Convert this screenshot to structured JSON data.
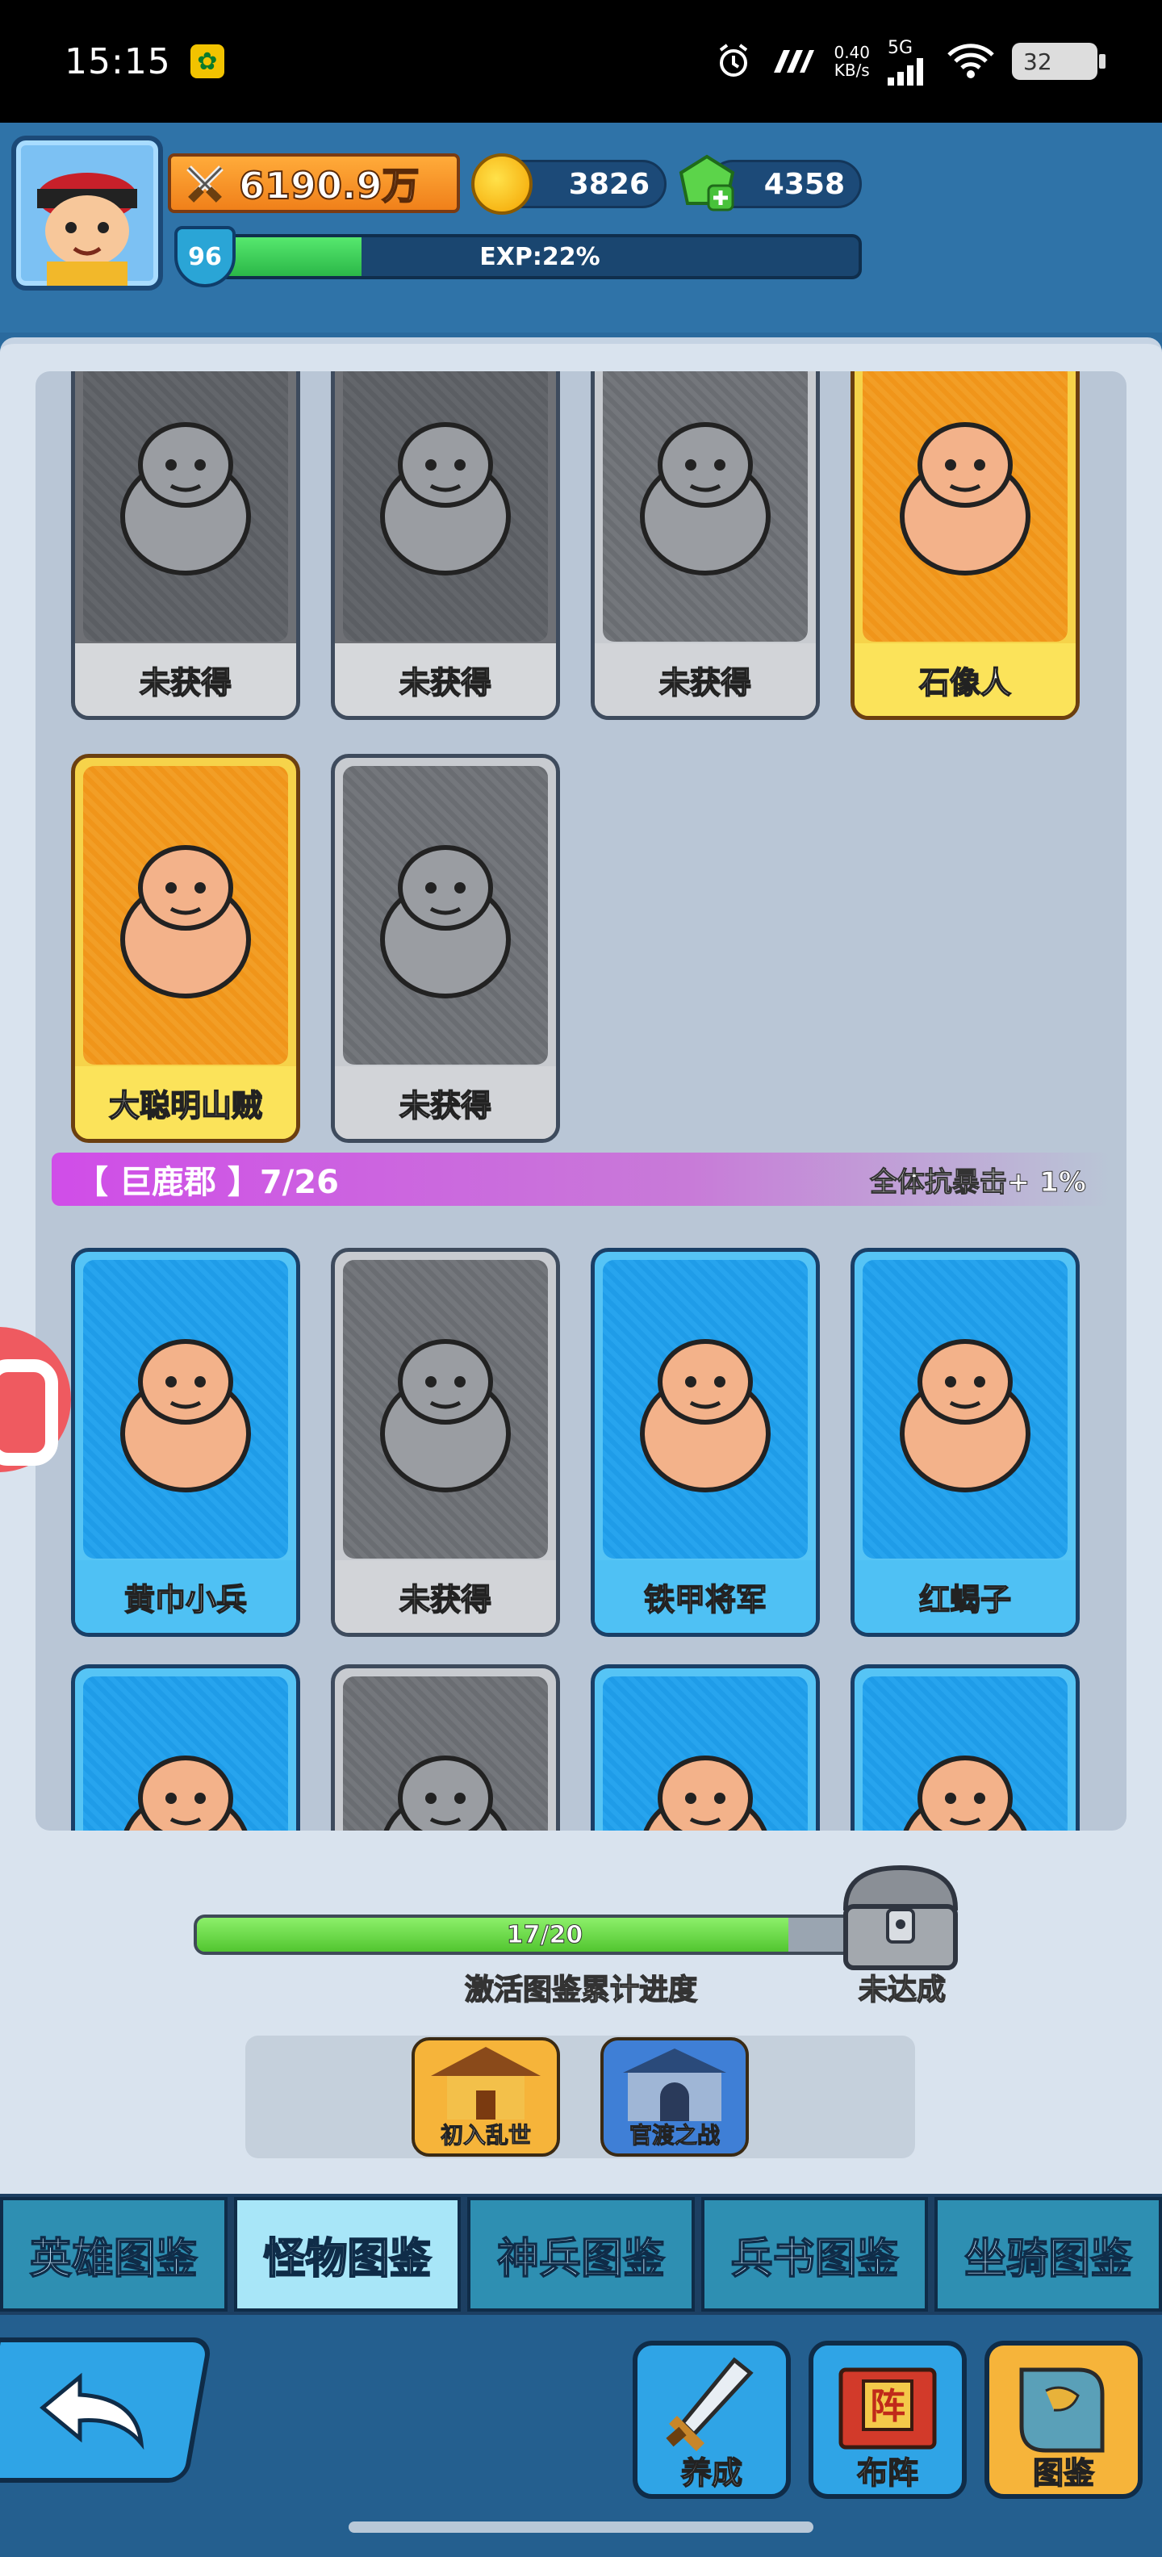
{
  "status_bar": {
    "time": "15:15",
    "network_speed": "0.40\nKB/s",
    "network_type": "5G",
    "battery": "32"
  },
  "player": {
    "power": "6190.9万",
    "coins": "3826",
    "gems": "4358",
    "level": "96",
    "exp_text": "EXP:22%",
    "exp_fraction": 0.22
  },
  "collection": {
    "top_rows": [
      [
        {
          "name": "未获得",
          "style": "gray-dark",
          "icon": "boar-icon"
        },
        {
          "name": "未获得",
          "style": "gray-dark",
          "icon": "spider-icon"
        },
        {
          "name": "未获得",
          "style": "gray",
          "icon": "bandit-icon"
        },
        {
          "name": "石像人",
          "style": "gold",
          "icon": "stone-golem-icon"
        }
      ],
      [
        {
          "name": "大聪明山贼",
          "style": "gold",
          "icon": "axe-bandit-icon"
        },
        {
          "name": "未获得",
          "style": "gray",
          "icon": "taoist-icon"
        }
      ]
    ],
    "region": {
      "title": "【 巨鹿郡 】7/26",
      "bonus": "全体抗暴击+ 1%"
    },
    "region_rows": [
      [
        {
          "name": "黄巾小兵",
          "style": "blue",
          "icon": "yellow-turban-soldier-icon"
        },
        {
          "name": "未获得",
          "style": "gray",
          "icon": "turtle-icon"
        },
        {
          "name": "铁甲将军",
          "style": "blue",
          "icon": "beetle-icon"
        },
        {
          "name": "红蝎子",
          "style": "blue",
          "icon": "scorpion-icon"
        }
      ],
      [
        {
          "name": "",
          "style": "blue",
          "icon": "boar-icon"
        },
        {
          "name": "",
          "style": "gray",
          "icon": "soldier-icon"
        },
        {
          "name": "",
          "style": "blue",
          "icon": "rat-icon"
        },
        {
          "name": "",
          "style": "blue",
          "icon": "cat-icon"
        }
      ]
    ]
  },
  "progress": {
    "text": "17/20",
    "fraction": 0.85,
    "label": "激活图鉴累计进度",
    "chest_label": "未达成"
  },
  "books": [
    {
      "label": "初入乱世",
      "color": "#f6b43a"
    },
    {
      "label": "官渡之战",
      "color": "#3f7fd6"
    }
  ],
  "tabs": [
    {
      "label": "英雄图鉴",
      "active": false
    },
    {
      "label": "怪物图鉴",
      "active": true
    },
    {
      "label": "神兵图鉴",
      "active": false
    },
    {
      "label": "兵书图鉴",
      "active": false
    },
    {
      "label": "坐骑图鉴",
      "active": false
    }
  ],
  "bottom_nav": [
    {
      "label": "养成",
      "style": "blue",
      "icon": "sword-icon"
    },
    {
      "label": "布阵",
      "style": "blue",
      "icon": "formation-scroll-icon"
    },
    {
      "label": "图鉴",
      "style": "gold",
      "icon": "book-icon"
    }
  ],
  "bottom_nav_formation_glyph": "阵"
}
